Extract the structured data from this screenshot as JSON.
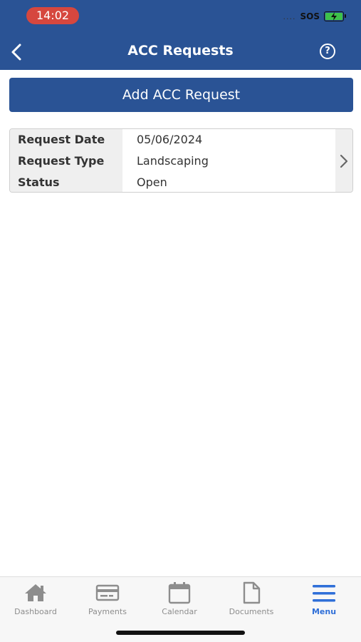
{
  "status_bar": {
    "time": "14:02",
    "carrier": "SOS",
    "signal_icon": "signal-dots-icon",
    "battery_icon": "battery-charging-icon"
  },
  "header": {
    "title": "ACC Requests",
    "back_icon": "chevron-left-icon",
    "help_icon": "help-circle-icon",
    "help_glyph": "?"
  },
  "actions": {
    "add_label": "Add ACC Request"
  },
  "requests": [
    {
      "fields": [
        {
          "label": "Request Date",
          "value": "05/06/2024"
        },
        {
          "label": "Request Type",
          "value": "Landscaping"
        },
        {
          "label": "Status",
          "value": "Open"
        }
      ]
    }
  ],
  "tabbar": {
    "items": [
      {
        "label": "Dashboard",
        "icon": "home-icon"
      },
      {
        "label": "Payments",
        "icon": "credit-card-icon"
      },
      {
        "label": "Calendar",
        "icon": "calendar-icon"
      },
      {
        "label": "Documents",
        "icon": "document-icon"
      },
      {
        "label": "Menu",
        "icon": "hamburger-menu-icon"
      }
    ],
    "active": "Menu"
  },
  "colors": {
    "primary": "#2a5395",
    "time_pill": "#d6473e",
    "active_tab": "#2f6fd8",
    "inactive_tab": "#8d8d8d"
  }
}
